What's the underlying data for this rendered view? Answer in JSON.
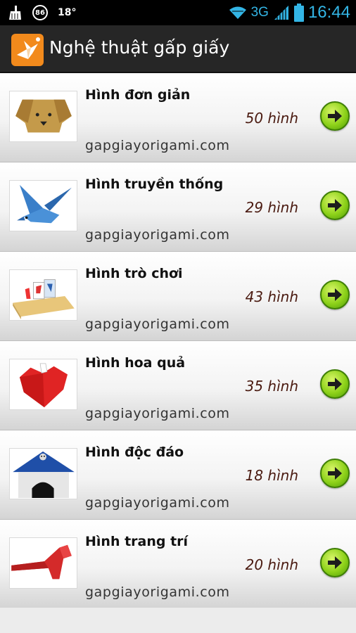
{
  "status_bar": {
    "notification_count": "86",
    "temperature": "18°",
    "network": "3G",
    "time": "16:44"
  },
  "action_bar": {
    "title": "Nghệ thuật gấp giấy"
  },
  "items": [
    {
      "title": "Hình đơn giản",
      "count": "50 hình",
      "site": "gapgiayorigami.com"
    },
    {
      "title": "Hình truyền thống",
      "count": "29 hình",
      "site": "gapgiayorigami.com"
    },
    {
      "title": "Hình trò chơi",
      "count": "43 hình",
      "site": "gapgiayorigami.com"
    },
    {
      "title": "Hình hoa quả",
      "count": "35 hình",
      "site": "gapgiayorigami.com"
    },
    {
      "title": "Hình độc đáo",
      "count": "18 hình",
      "site": "gapgiayorigami.com"
    },
    {
      "title": "Hình trang trí",
      "count": "20 hình",
      "site": "gapgiayorigami.com"
    }
  ],
  "icons": {
    "app": "origami-bird-icon",
    "go": "arrow-right-icon"
  },
  "colors": {
    "accent_blue": "#33b5e5",
    "action_bar": "#262626",
    "app_icon_bg": "#f28a1c",
    "go_button": "#8ed21a",
    "count_text": "#4a1a10"
  }
}
